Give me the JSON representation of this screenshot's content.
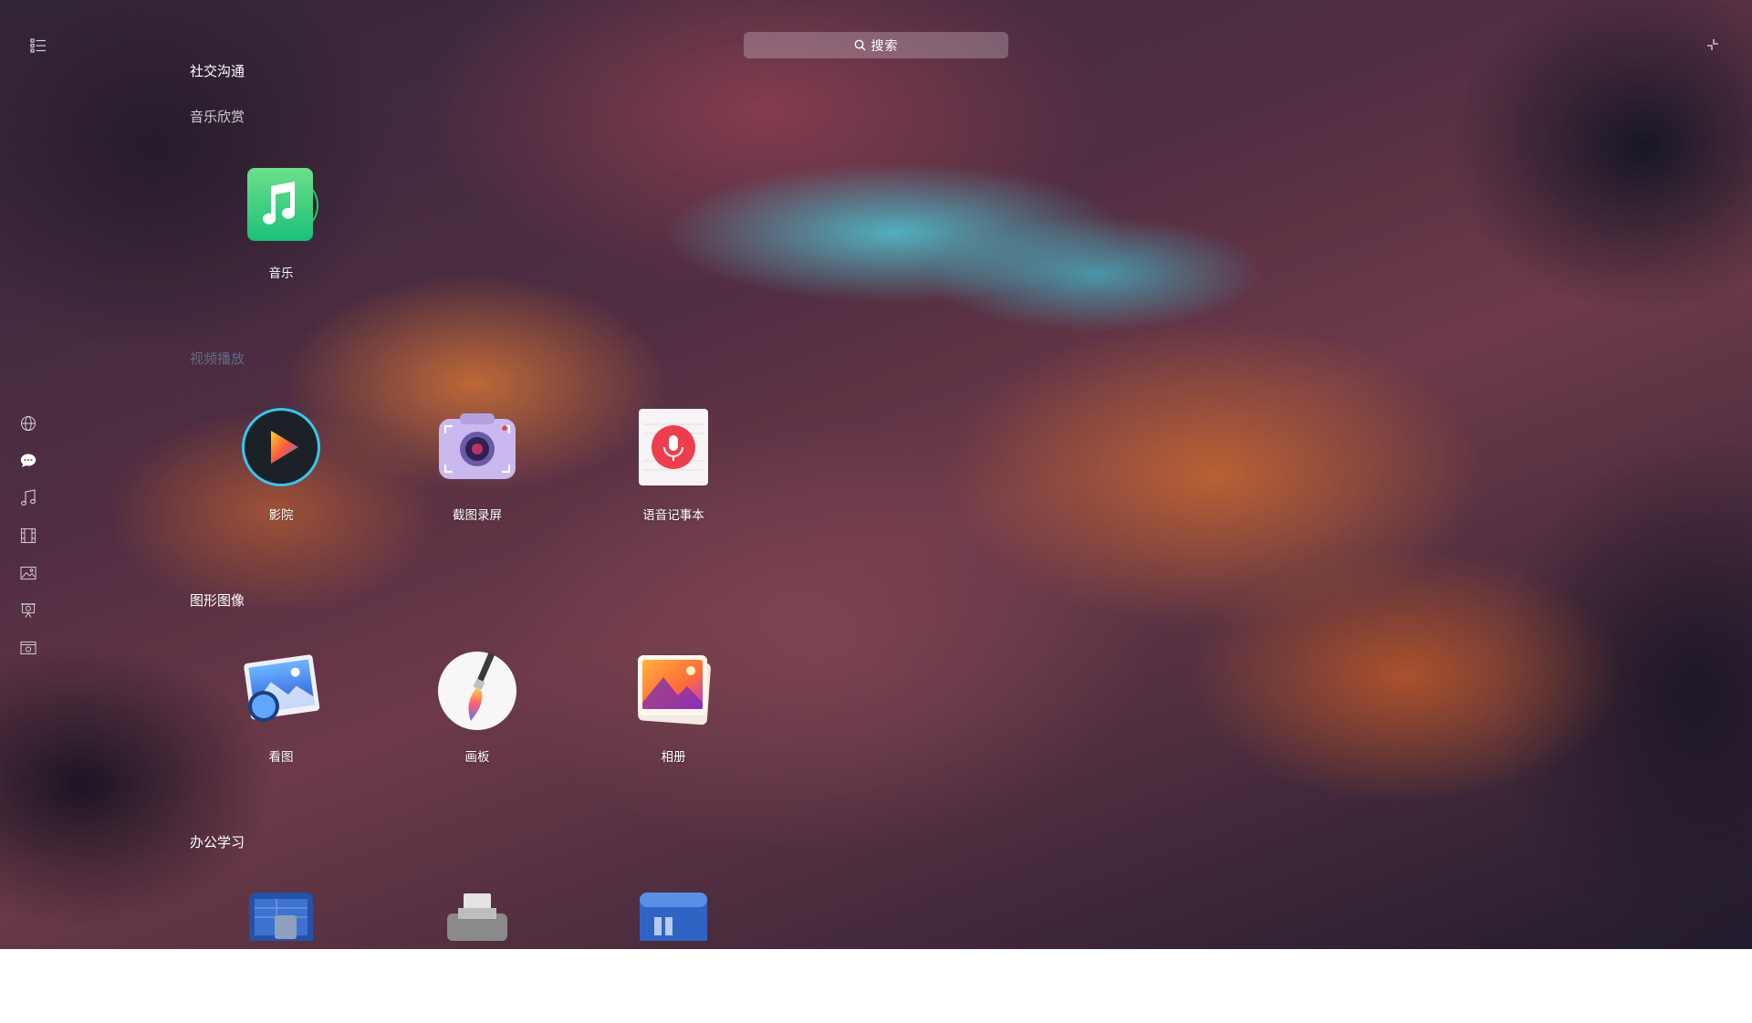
{
  "search": {
    "placeholder": "搜索"
  },
  "top_bar": {
    "mode_icon": "list-view-icon",
    "fullscreen_icon": "exit-fullscreen-icon"
  },
  "category_nav": [
    {
      "icon": "globe-icon",
      "name": "internet"
    },
    {
      "icon": "chat-icon",
      "name": "social",
      "active": true
    },
    {
      "icon": "music-note-icon",
      "name": "music"
    },
    {
      "icon": "film-icon",
      "name": "video"
    },
    {
      "icon": "image-icon",
      "name": "graphics"
    },
    {
      "icon": "presentation-icon",
      "name": "office"
    },
    {
      "icon": "settings-box-icon",
      "name": "system"
    }
  ],
  "sections": {
    "social": {
      "title": "社交沟通"
    },
    "music": {
      "title": "音乐欣赏",
      "apps": [
        {
          "label": "音乐",
          "icon": "music-app-icon",
          "color": "#3cd37a"
        }
      ]
    },
    "video": {
      "title": "视频播放",
      "apps": [
        {
          "label": "影院",
          "icon": "movie-player-icon",
          "color": "#20262e"
        },
        {
          "label": "截图录屏",
          "icon": "screenshot-camera-icon",
          "color": "#b7a6e0"
        },
        {
          "label": "语音记事本",
          "icon": "voice-note-icon",
          "color": "#f04a4a"
        }
      ]
    },
    "graphics": {
      "title": "图形图像",
      "apps": [
        {
          "label": "看图",
          "icon": "image-viewer-icon",
          "color": "#3b7be0"
        },
        {
          "label": "画板",
          "icon": "paintbrush-icon",
          "color": "#ffffff"
        },
        {
          "label": "相册",
          "icon": "photo-album-icon",
          "color": "#f08a2a"
        }
      ]
    },
    "office": {
      "title": "办公学习",
      "apps": [
        {
          "label": "",
          "icon": "document-viewer-icon",
          "color": "#2a5fb0"
        },
        {
          "label": "",
          "icon": "printer-icon",
          "color": "#d8d8d8"
        },
        {
          "label": "",
          "icon": "presentation-app-icon",
          "color": "#2f6fd0"
        }
      ]
    }
  }
}
